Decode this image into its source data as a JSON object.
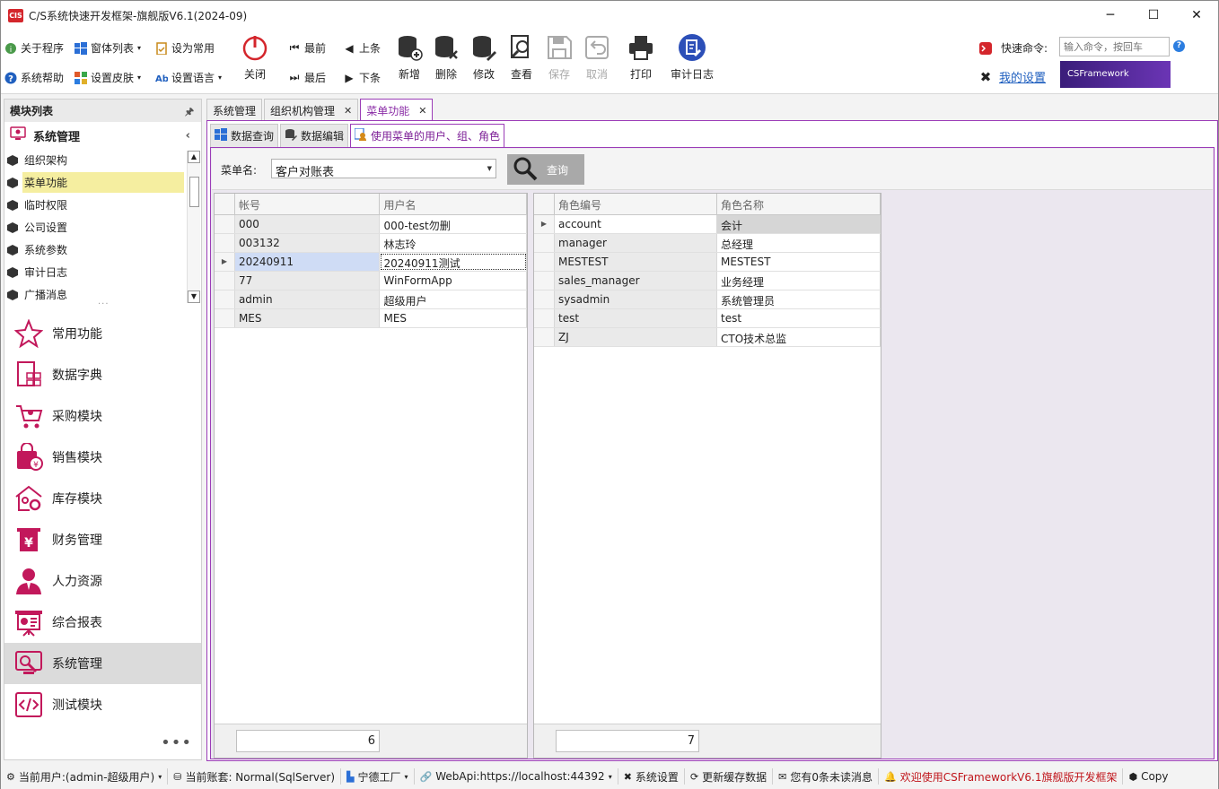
{
  "window": {
    "title": "C/S系统快速开发框架-旗舰版V6.1(2024-09)",
    "logo": "CIS",
    "controls": [
      "─",
      "☐",
      "✕"
    ]
  },
  "ribbon": {
    "small": [
      {
        "name": "about",
        "label": "关于程序"
      },
      {
        "name": "window-list",
        "label": "窗体列表"
      },
      {
        "name": "set-common",
        "label": "设为常用"
      },
      {
        "name": "system-help",
        "label": "系统帮助"
      },
      {
        "name": "set-skin",
        "label": "设置皮肤"
      },
      {
        "name": "set-language",
        "label": "设置语言"
      },
      {
        "name": "first",
        "label": "最前"
      },
      {
        "name": "prev",
        "label": "上条"
      },
      {
        "name": "last",
        "label": "最后"
      },
      {
        "name": "next",
        "label": "下条"
      }
    ],
    "close": "关闭",
    "big": [
      "新增",
      "删除",
      "修改",
      "查看",
      "保存",
      "取消",
      "打印",
      "审计日志"
    ],
    "quick_cmd_label": "快速命令:",
    "quick_cmd_placeholder": "输入命令，按回车",
    "my_settings": "我的设置",
    "banner": "CSFramework"
  },
  "left_panel": {
    "title": "模块列表",
    "group": "系统管理",
    "tree": [
      "组织架构",
      "菜单功能",
      "临时权限",
      "公司设置",
      "系统参数",
      "审计日志",
      "广播消息"
    ],
    "nav": [
      "常用功能",
      "数据字典",
      "采购模块",
      "销售模块",
      "库存模块",
      "财务管理",
      "人力资源",
      "综合报表",
      "系统管理",
      "测试模块"
    ],
    "more": "•••"
  },
  "tabs": [
    {
      "label": "系统管理",
      "closable": false
    },
    {
      "label": "组织机构管理",
      "closable": true
    },
    {
      "label": "菜单功能",
      "closable": true
    }
  ],
  "subtabs": [
    "数据查询",
    "数据编辑",
    "使用菜单的用户、组、角色"
  ],
  "query": {
    "label": "菜单名:",
    "value": "客户对账表",
    "button": "查询"
  },
  "users_grid": {
    "columns": [
      "帐号",
      "用户名"
    ],
    "rows": [
      [
        "000",
        "000-test勿删"
      ],
      [
        "003132",
        "林志玲"
      ],
      [
        "20240911",
        "20240911测试"
      ],
      [
        "77",
        "WinFormApp"
      ],
      [
        "admin",
        "超级用户"
      ],
      [
        "MES",
        "MES"
      ]
    ],
    "selected_row": 2,
    "count": "6"
  },
  "roles_grid": {
    "columns": [
      "角色编号",
      "角色名称"
    ],
    "rows": [
      [
        "account",
        "会计"
      ],
      [
        "manager",
        "总经理"
      ],
      [
        "MESTEST",
        "MESTEST"
      ],
      [
        "sales_manager",
        "业务经理"
      ],
      [
        "sysadmin",
        "系统管理员"
      ],
      [
        "test",
        "test"
      ],
      [
        "ZJ",
        "CTO技术总监"
      ]
    ],
    "selected_row": 0,
    "count": "7"
  },
  "status": [
    "当前用户:(admin-超级用户)",
    "当前账套: Normal(SqlServer)",
    "宁德工厂",
    "WebApi:https://localhost:44392",
    "系统设置",
    "更新缓存数据",
    "您有0条未读消息",
    "欢迎使用CSFrameworkV6.1旗舰版开发框架",
    "Copy"
  ],
  "colors": {
    "accent": "#9b3cb7",
    "brand_red": "#d4262c",
    "icon_pink": "#c2185b"
  }
}
